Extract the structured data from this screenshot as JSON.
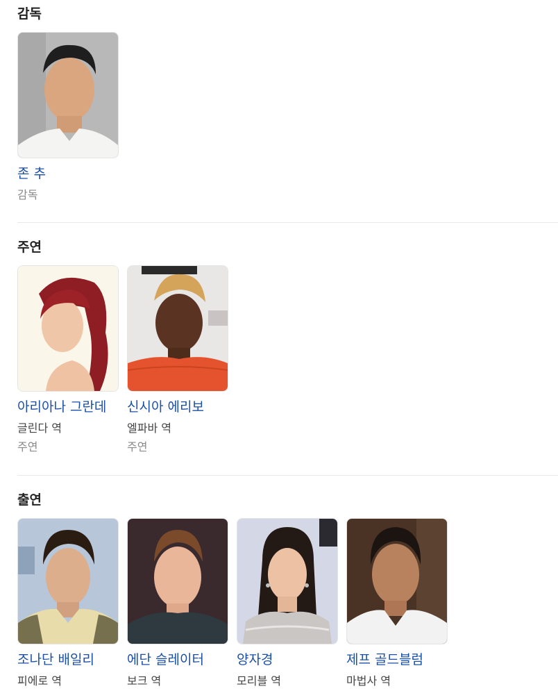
{
  "sections": [
    {
      "title": "감독",
      "people": [
        {
          "name": "존 추",
          "role": "",
          "label": "감독"
        }
      ]
    },
    {
      "title": "주연",
      "people": [
        {
          "name": "아리아나 그란데",
          "role": "글린다 역",
          "label": "주연"
        },
        {
          "name": "신시아 에리보",
          "role": "엘파바 역",
          "label": "주연"
        }
      ]
    },
    {
      "title": "출연",
      "people": [
        {
          "name": "조나단 배일리",
          "role": "피에로 역"
        },
        {
          "name": "에단 슬레이터",
          "role": "보크 역"
        },
        {
          "name": "양자경",
          "role": "모리블 역"
        },
        {
          "name": "제프 골드블럼",
          "role": "마법사 역"
        }
      ]
    }
  ],
  "colors": {
    "name_link": "#1a4fa6",
    "role_text": "#444444",
    "secondary_text": "#8a8a8a",
    "divider": "#e8e8e8"
  }
}
